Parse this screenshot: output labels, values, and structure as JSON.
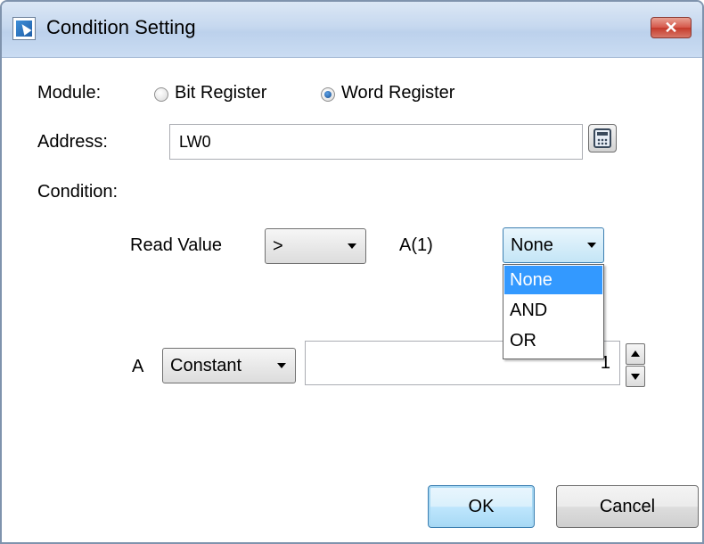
{
  "window": {
    "title": "Condition Setting",
    "close_glyph": "✕"
  },
  "module": {
    "label": "Module:",
    "options": [
      {
        "label": "Bit Register",
        "checked": false
      },
      {
        "label": "Word Register",
        "checked": true
      }
    ]
  },
  "address": {
    "label": "Address:",
    "value": "LW0"
  },
  "condition": {
    "label": "Condition:",
    "read_value_label": "Read Value",
    "operator_value": ">",
    "expression_label": "A(1)",
    "logic_value": "None",
    "logic_options": [
      "None",
      "AND",
      "OR"
    ]
  },
  "operand": {
    "label": "A",
    "source_value": "Constant",
    "number_value": "1"
  },
  "buttons": {
    "ok": "OK",
    "cancel": "Cancel"
  },
  "colors": {
    "selection": "#3399ff",
    "close_button": "#c53a2b",
    "focus_border": "#3c7fb1"
  }
}
